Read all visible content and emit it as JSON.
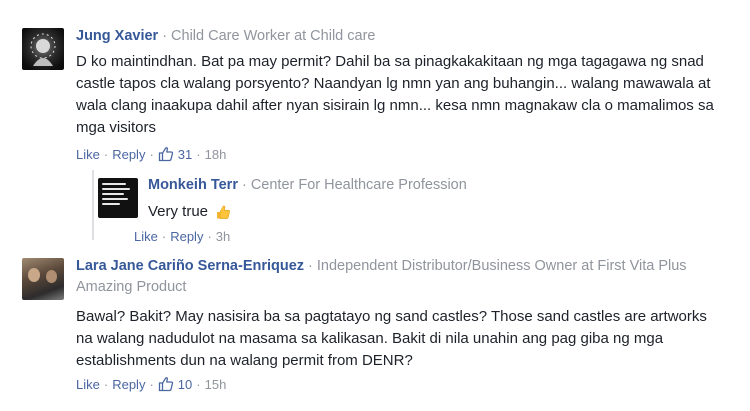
{
  "comments": [
    {
      "author": "Jung Xavier",
      "work": "Child Care Worker at Child care",
      "lines": [
        "D ko maintindhan. Bat pa may permit? Dahil ba sa pinagkakakitaan ng mga tagagawa ng snad",
        "castle tapos cla walang porsyento? Naandyan lg nmn yan ang buhangin... walang mawawala at",
        "wala clang inaakupa dahil after nyan sisirain lg nmn... kesa nmn magnakaw cla o mamalimos sa",
        "mga visitors"
      ],
      "like_label": "Like",
      "reply_label": "Reply",
      "likes": "31",
      "time": "18h"
    },
    {
      "author": "Monkeih Terr",
      "work": "Center For Healthcare Profession",
      "lines": [
        "Very true"
      ],
      "like_label": "Like",
      "reply_label": "Reply",
      "time": "3h"
    },
    {
      "author": "Lara Jane Cariño Serna-Enriquez",
      "work": "Independent Distributor/Business Owner at First Vita Plus",
      "work_line2": "Amazing Product",
      "lines": [
        "Bawal? Bakit? May nasisira ba sa pagtatayo ng sand castles? Those sand castles are artworks",
        "na walang nadudulot na masama sa kalikasan. Bakit di nila unahin ang pag giba ng mga",
        "establishments dun na walang permit from DENR?"
      ],
      "like_label": "Like",
      "reply_label": "Reply",
      "likes": "10",
      "time": "15h"
    }
  ],
  "separator": "·",
  "colors": {
    "author": "#365899",
    "meta": "#90949c",
    "link": "#4b67a1",
    "text": "#1d2129"
  }
}
